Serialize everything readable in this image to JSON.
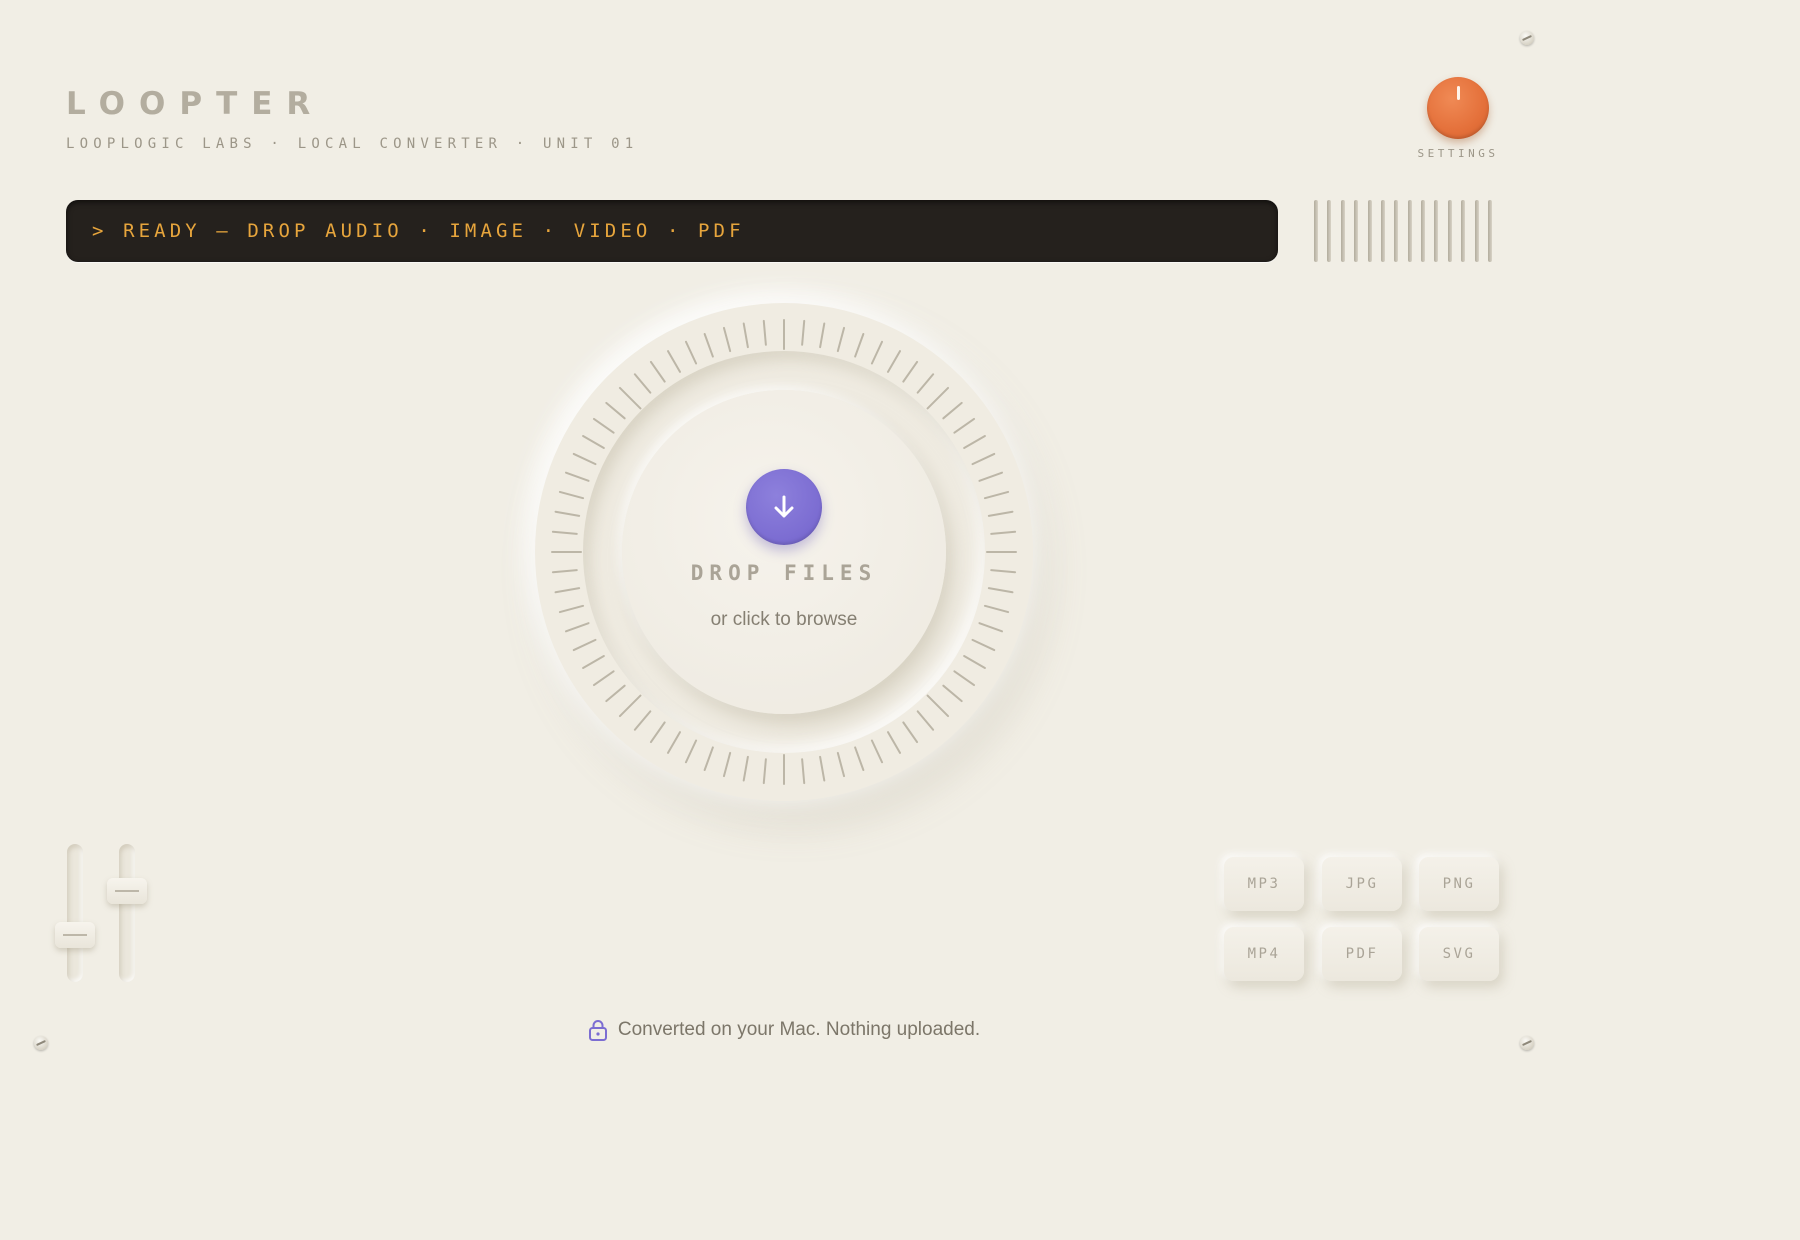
{
  "brand": {
    "title": "LOOPTER",
    "subtitle": "LOOPLOGIC LABS · LOCAL CONVERTER · UNIT 01"
  },
  "settings": {
    "label": "SETTINGS",
    "accent": "#e4703a"
  },
  "display": {
    "status_text": "> READY — DROP AUDIO · IMAGE · VIDEO · PDF",
    "text_color": "#e7a53c"
  },
  "dropzone": {
    "title": "DROP FILES",
    "subtitle": "or click to browse",
    "icon": "arrow-down-icon",
    "accent": "#7c6dd2"
  },
  "faders": [
    {
      "name": "left-fader",
      "level": 0.3
    },
    {
      "name": "right-fader",
      "level": 0.7
    }
  ],
  "formats": [
    "MP3",
    "JPG",
    "PNG",
    "MP4",
    "PDF",
    "SVG"
  ],
  "footer": {
    "icon": "lock-icon",
    "text": "Converted on your Mac. Nothing uploaded."
  }
}
